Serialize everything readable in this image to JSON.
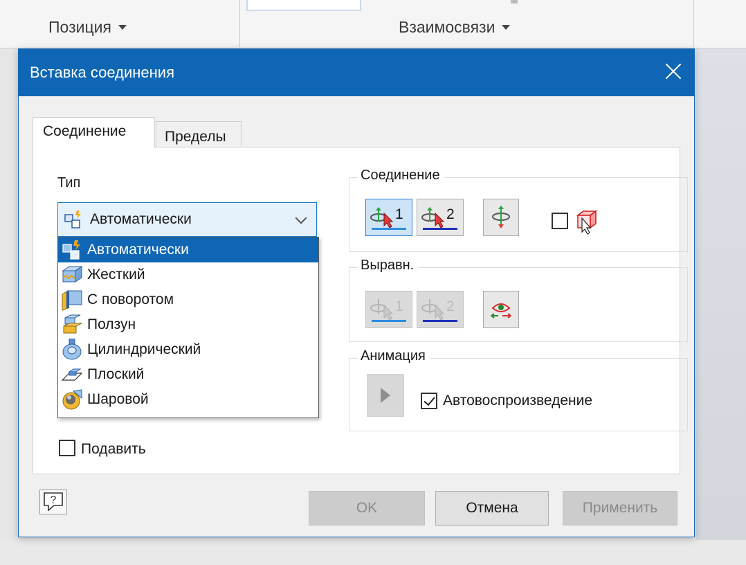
{
  "ribbon": {
    "panel_position": "Позиция",
    "panel_relations": "Взаимосвязи"
  },
  "dialog": {
    "title": "Вставка соединения",
    "tabs": [
      "Соединение",
      "Пределы"
    ],
    "type_label": "Тип",
    "type_selected": "Автоматически",
    "type_options": [
      {
        "label": "Автоматически",
        "icon": "auto-joint-icon",
        "selected": true
      },
      {
        "label": "Жесткий",
        "icon": "rigid-joint-icon",
        "selected": false
      },
      {
        "label": "С поворотом",
        "icon": "rotational-joint-icon",
        "selected": false
      },
      {
        "label": "Ползун",
        "icon": "slider-joint-icon",
        "selected": false
      },
      {
        "label": "Цилиндрический",
        "icon": "cylindrical-joint-icon",
        "selected": false
      },
      {
        "label": "Плоский",
        "icon": "planar-joint-icon",
        "selected": false
      },
      {
        "label": "Шаровой",
        "icon": "ball-joint-icon",
        "selected": false
      }
    ],
    "suppress_label": "Подавить",
    "connection_group": {
      "title": "Соединение",
      "origin1": "1",
      "origin2": "2"
    },
    "align_group": {
      "title": "Выравн.",
      "align1": "1",
      "align2": "2"
    },
    "animation_group": {
      "title": "Анимация",
      "autoplay_label": "Автовоспроизведение",
      "autoplay_checked": true
    },
    "buttons": {
      "ok": "OK",
      "cancel": "Отмена",
      "apply": "Применить"
    },
    "colors": {
      "title_bar": "#0f66b5",
      "selection": "#0f66b5",
      "underline_1": "#2f8ce0",
      "underline_2": "#1c2fb8"
    }
  }
}
